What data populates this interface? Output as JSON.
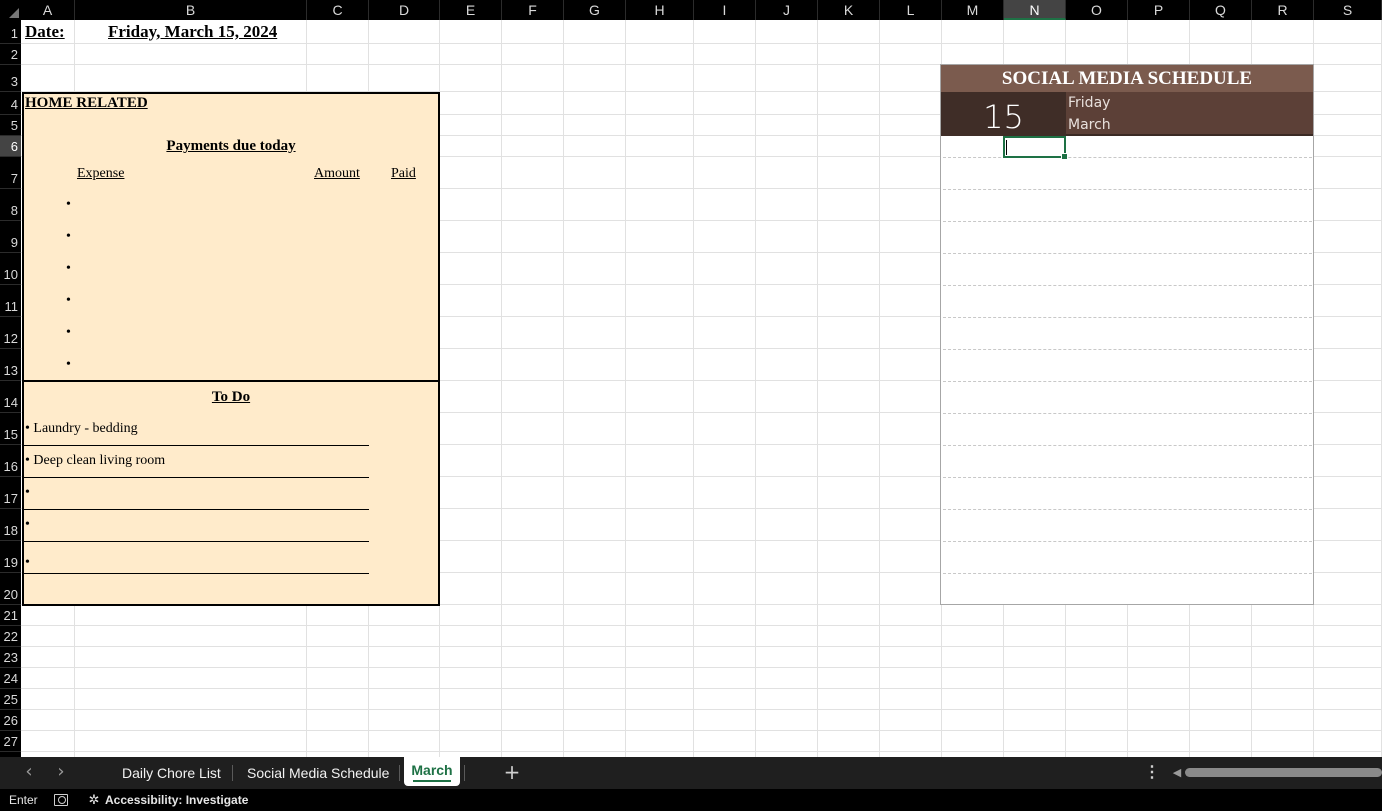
{
  "columns": [
    "A",
    "B",
    "C",
    "D",
    "E",
    "F",
    "G",
    "H",
    "I",
    "J",
    "K",
    "L",
    "M",
    "N",
    "O",
    "P",
    "Q",
    "R",
    "S"
  ],
  "rows": [
    "1",
    "2",
    "3",
    "4",
    "5",
    "6",
    "7",
    "8",
    "9",
    "10",
    "11",
    "12",
    "13",
    "14",
    "15",
    "16",
    "17",
    "18",
    "19",
    "20",
    "21",
    "22",
    "23",
    "24",
    "25",
    "26",
    "27"
  ],
  "selected_cell": {
    "column": "N",
    "row": "6"
  },
  "sheet": {
    "date_label": "Date:",
    "date_value": "Friday, March 15, 2024",
    "home": {
      "title": "HOME RELATED",
      "payments_title": "Payments due today",
      "headers": {
        "expense": "Expense",
        "amount": "Amount",
        "paid": "Paid"
      },
      "bullets": [
        "•",
        "•",
        "•",
        "•",
        "•",
        "•"
      ],
      "todo_title": "To Do",
      "todo_items": [
        "• Laundry - bedding",
        "• Deep clean living room",
        "•",
        "•",
        "•"
      ]
    },
    "social": {
      "title": "SOCIAL MEDIA SCHEDULE",
      "day_number": "15",
      "weekday": "Friday",
      "month": "March"
    }
  },
  "tabs": {
    "prev_icon": "chevron-left-icon",
    "next_icon": "chevron-right-icon",
    "items": [
      "Daily Chore List",
      "Social Media Schedule",
      "March"
    ],
    "active": "March",
    "add_icon": "+",
    "more_icon": "⋮"
  },
  "status": {
    "mode": "Enter",
    "accessibility": "Accessibility: Investigate"
  },
  "colors": {
    "panel_bg": "#ffebcb",
    "sm_title_bg": "#7b5b4e",
    "sm_date_bg": "#5c4037",
    "sm_daynum_bg": "#3f2d27",
    "accent_green": "#1e7145"
  }
}
